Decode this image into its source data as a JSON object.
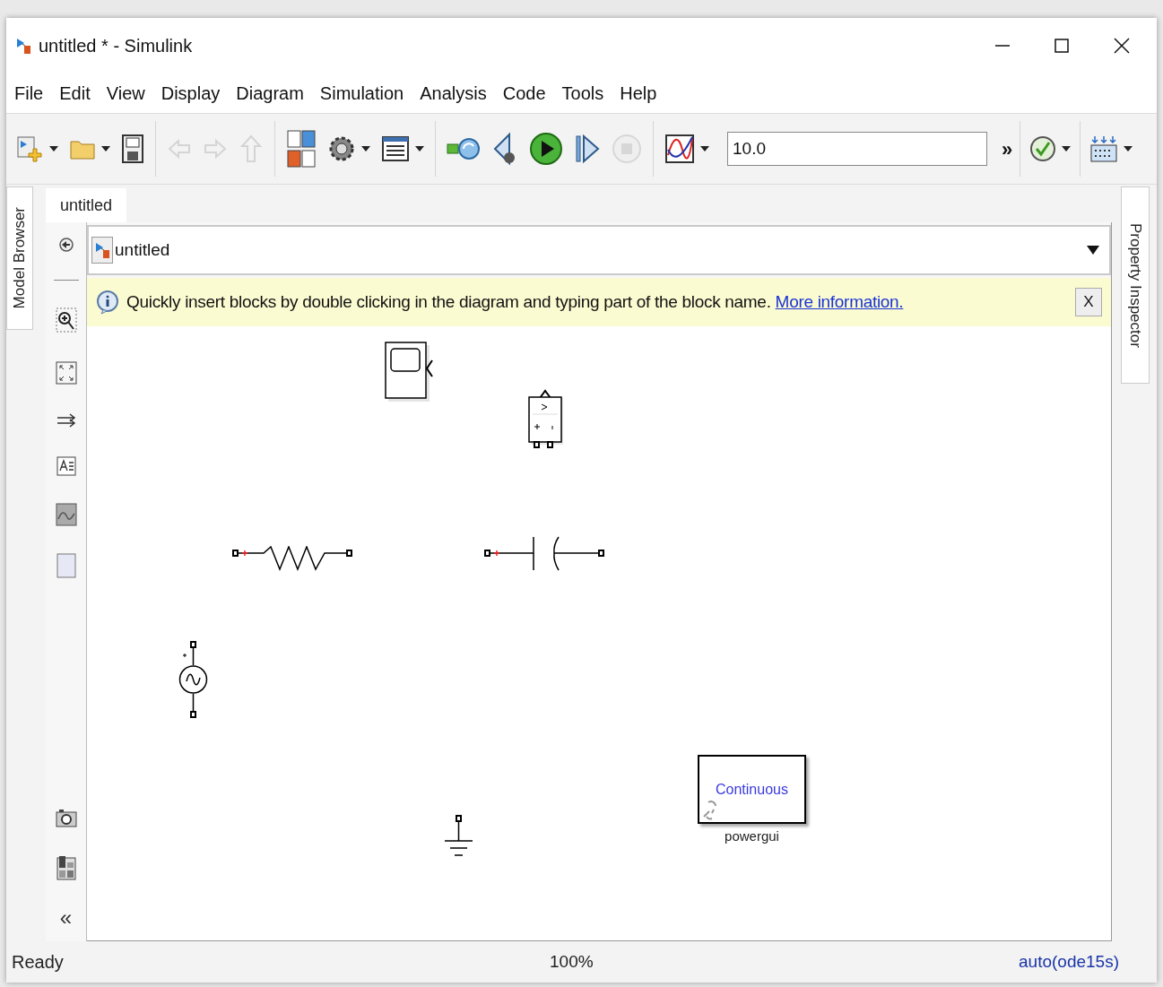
{
  "window": {
    "title": "untitled * - Simulink"
  },
  "menu": [
    "File",
    "Edit",
    "View",
    "Display",
    "Diagram",
    "Simulation",
    "Analysis",
    "Code",
    "Tools",
    "Help"
  ],
  "toolbar": {
    "items": [
      {
        "kind": "new-model",
        "disabled": false,
        "dropdown": true
      },
      {
        "kind": "open",
        "disabled": false,
        "dropdown": true
      },
      {
        "kind": "save",
        "disabled": false,
        "dropdown": false
      },
      {
        "kind": "sep"
      },
      {
        "kind": "back",
        "disabled": true,
        "dropdown": false
      },
      {
        "kind": "forward",
        "disabled": true,
        "dropdown": false
      },
      {
        "kind": "up",
        "disabled": true,
        "dropdown": false
      },
      {
        "kind": "sep"
      },
      {
        "kind": "library",
        "disabled": false,
        "dropdown": false
      },
      {
        "kind": "settings",
        "disabled": false,
        "dropdown": true
      },
      {
        "kind": "explorer",
        "disabled": false,
        "dropdown": true
      },
      {
        "kind": "sep"
      },
      {
        "kind": "update",
        "disabled": false,
        "dropdown": false
      },
      {
        "kind": "step-back",
        "disabled": false,
        "dropdown": false
      },
      {
        "kind": "run",
        "disabled": false,
        "dropdown": false
      },
      {
        "kind": "step-forward",
        "disabled": false,
        "dropdown": false
      },
      {
        "kind": "stop",
        "disabled": true,
        "dropdown": false
      },
      {
        "kind": "sep"
      },
      {
        "kind": "inspector",
        "disabled": false,
        "dropdown": true
      }
    ],
    "stop_time": "10.0",
    "overflow": "»"
  },
  "side_tabs": {
    "left": "Model Browser",
    "right": "Property Inspector"
  },
  "tabs": [
    {
      "label": "untitled",
      "selected": true
    }
  ],
  "breadcrumb": "untitled",
  "palette": {
    "items": [
      {
        "kind": "back"
      },
      {
        "kind": "sep"
      },
      {
        "kind": "zoom"
      },
      {
        "kind": "fit"
      },
      {
        "kind": "arrows"
      },
      {
        "kind": "annotation"
      },
      {
        "kind": "image"
      },
      {
        "kind": "area"
      },
      {
        "kind": "gap"
      },
      {
        "kind": "camera"
      },
      {
        "kind": "layout"
      }
    ],
    "collapse": "«"
  },
  "info_bar": {
    "message": "Quickly insert blocks by double clicking in the diagram and typing part of the block name.",
    "link": "More information.",
    "close": "X"
  },
  "blocks": [
    {
      "kind": "scope"
    },
    {
      "kind": "voltage-measurement"
    },
    {
      "kind": "resistor"
    },
    {
      "kind": "capacitor"
    },
    {
      "kind": "ac-source"
    },
    {
      "kind": "ground"
    },
    {
      "kind": "powergui",
      "text": "Continuous",
      "label": "powergui"
    }
  ],
  "status_bar": {
    "state": "Ready",
    "zoom": "100%",
    "solver": "auto(ode15s)"
  }
}
